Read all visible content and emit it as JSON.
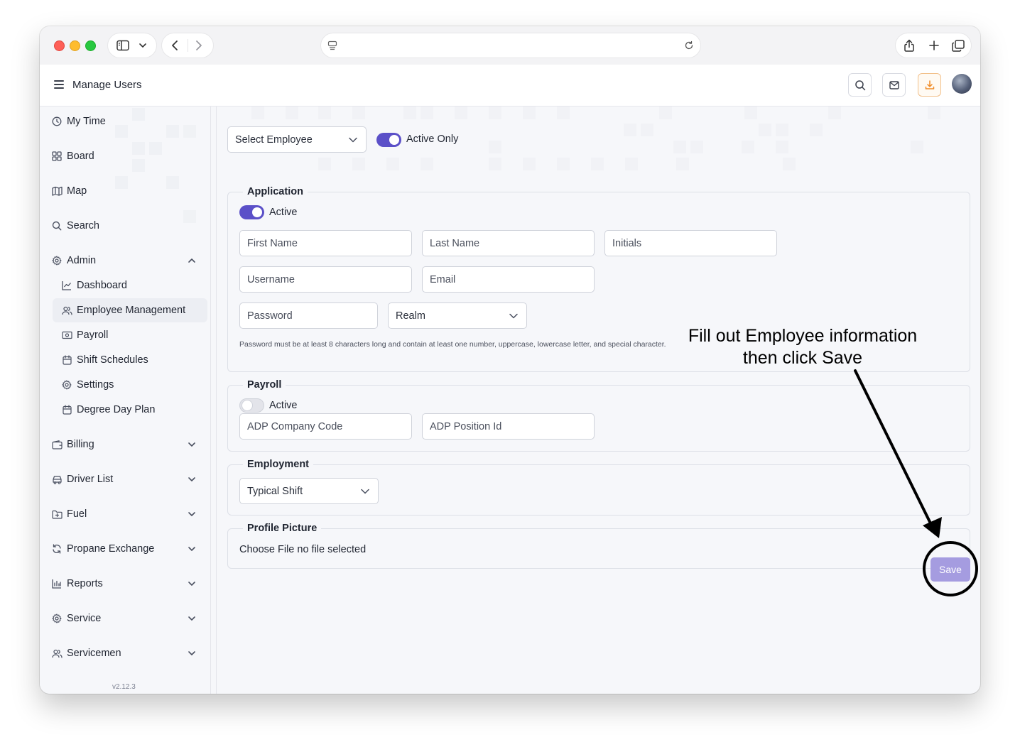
{
  "app": {
    "title": "Manage Users"
  },
  "sidebar": {
    "items": [
      {
        "label": "My Time",
        "icon": "clock-icon"
      },
      {
        "label": "Board",
        "icon": "grid-icon"
      },
      {
        "label": "Map",
        "icon": "map-icon"
      },
      {
        "label": "Search",
        "icon": "search-icon"
      },
      {
        "label": "Admin",
        "icon": "gear-icon",
        "expanded": true
      },
      {
        "label": "Billing",
        "icon": "wallet-icon"
      },
      {
        "label": "Driver List",
        "icon": "truck-icon"
      },
      {
        "label": "Fuel",
        "icon": "folder-plus-icon"
      },
      {
        "label": "Propane Exchange",
        "icon": "refresh-icon"
      },
      {
        "label": "Reports",
        "icon": "bar-chart-icon"
      },
      {
        "label": "Service",
        "icon": "gear-icon"
      },
      {
        "label": "Servicemen",
        "icon": "users-icon"
      }
    ],
    "admin_sub": [
      {
        "label": "Dashboard",
        "icon": "line-chart-icon"
      },
      {
        "label": "Employee Management",
        "icon": "users-icon",
        "active": true
      },
      {
        "label": "Payroll",
        "icon": "money-icon"
      },
      {
        "label": "Shift Schedules",
        "icon": "calendar-icon"
      },
      {
        "label": "Settings",
        "icon": "gear-icon"
      },
      {
        "label": "Degree Day Plan",
        "icon": "calendar-icon"
      }
    ],
    "version": "v2.12.3"
  },
  "toolbar": {
    "select_employee": "Select Employee",
    "active_only_label": "Active Only",
    "active_only_on": true
  },
  "application": {
    "legend": "Application",
    "active_label": "Active",
    "active_on": true,
    "first_name": "First Name",
    "last_name": "Last Name",
    "initials": "Initials",
    "username": "Username",
    "email": "Email",
    "password": "Password",
    "realm": "Realm",
    "password_hint": "Password must be at least 8 characters long and contain at least one number, uppercase, lowercase letter, and special character."
  },
  "payroll": {
    "legend": "Payroll",
    "active_label": "Active",
    "active_on": false,
    "adp_company_code": "ADP Company Code",
    "adp_position_id": "ADP Position Id"
  },
  "employment": {
    "legend": "Employment",
    "typical_shift": "Typical Shift"
  },
  "profile_picture": {
    "legend": "Profile Picture",
    "file_text": "Choose File no file selected"
  },
  "actions": {
    "save_label": "Save"
  },
  "annotation": {
    "line1": "Fill out Employee information",
    "line2": "then click Save"
  },
  "colors": {
    "accent": "#5b50c8",
    "save_button": "#a59ce0",
    "download_accent": "#f08a24"
  }
}
